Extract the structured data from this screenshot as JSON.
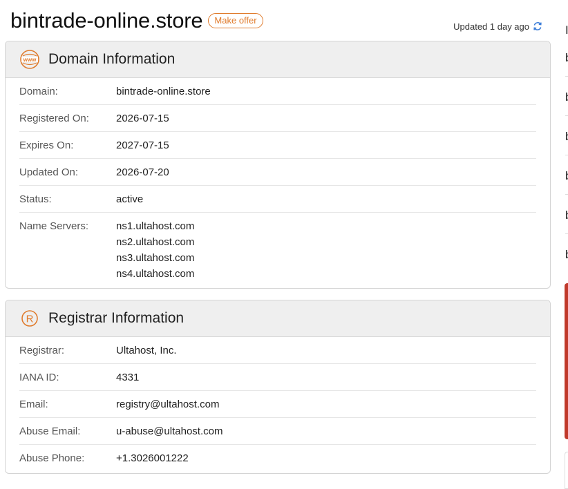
{
  "header": {
    "title": "bintrade-online.store",
    "offer_label": "Make offer",
    "updated_text": "Updated 1 day ago"
  },
  "domain_card": {
    "title": "Domain Information",
    "rows": [
      {
        "label": "Domain:",
        "value": "bintrade-online.store"
      },
      {
        "label": "Registered On:",
        "value": "2026-07-15"
      },
      {
        "label": "Expires On:",
        "value": "2027-07-15"
      },
      {
        "label": "Updated On:",
        "value": "2026-07-20"
      },
      {
        "label": "Status:",
        "value": "active"
      }
    ],
    "nameservers_label": "Name Servers:",
    "nameservers": [
      "ns1.ultahost.com",
      "ns2.ultahost.com",
      "ns3.ultahost.com",
      "ns4.ultahost.com"
    ]
  },
  "registrar_card": {
    "title": "Registrar Information",
    "rows": [
      {
        "label": "Registrar:",
        "value": "Ultahost, Inc."
      },
      {
        "label": "IANA ID:",
        "value": "4331"
      },
      {
        "label": "Email:",
        "value": "registry@ultahost.com"
      },
      {
        "label": "Abuse Email:",
        "value": "u-abuse@ultahost.com"
      },
      {
        "label": "Abuse Phone:",
        "value": "+1.3026001222"
      }
    ]
  },
  "sidebar": {
    "first_char": "I",
    "item_chars": [
      "b",
      "b",
      "b",
      "b",
      "b",
      "b"
    ]
  },
  "colors": {
    "accent": "#e07b2c",
    "refresh": "#3b7dd8",
    "side_red": "#c0392b"
  }
}
